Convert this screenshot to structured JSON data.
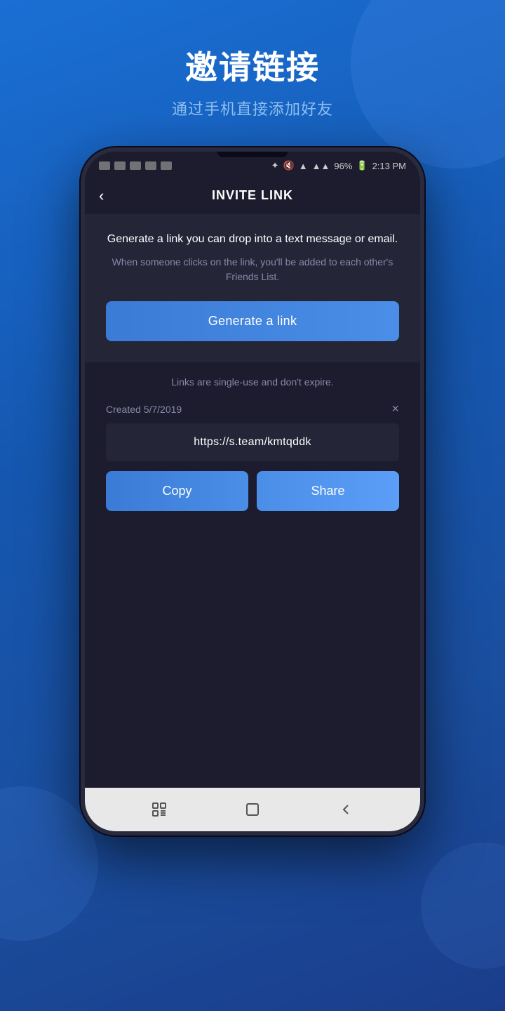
{
  "page": {
    "background": "#1557b0",
    "main_title": "邀请链接",
    "sub_title": "通过手机直接添加好友"
  },
  "status_bar": {
    "time": "2:13 PM",
    "battery": "96%",
    "signal": "●●●",
    "wifi": "wifi",
    "bluetooth": "BT"
  },
  "header": {
    "title": "INVITE LINK",
    "back_label": "‹"
  },
  "card": {
    "description": "Generate a link you can drop into a text\nmessage or email.",
    "sub_description": "When someone clicks on the link, you'll be added to\neach other's Friends List.",
    "generate_btn_label": "Generate a link"
  },
  "info": {
    "single_use_text": "Links are single-use and don't expire."
  },
  "link_item": {
    "created_label": "Created 5/7/2019",
    "close_icon": "×",
    "url": "https://s.team/kmtqddk",
    "copy_btn_label": "Copy",
    "share_btn_label": "Share"
  },
  "nav": {
    "back_icon": "back",
    "home_icon": "home",
    "recent_icon": "recent"
  }
}
